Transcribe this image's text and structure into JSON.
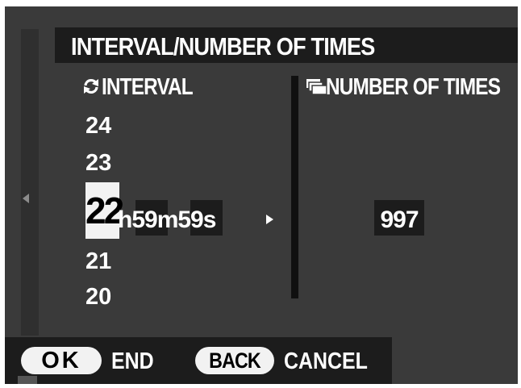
{
  "title": "INTERVAL/NUMBER OF TIMES",
  "interval": {
    "header": "INTERVAL",
    "icon": "cycle-arrows-icon",
    "hours_above": [
      "24",
      "23"
    ],
    "hours_selected": "22",
    "time_suffix": "h59m59s",
    "hours_below": [
      "21",
      "20"
    ]
  },
  "number_of_times": {
    "header": "NUMBER OF TIMES",
    "icon": "stacked-frames-icon",
    "value": "997"
  },
  "footer": {
    "ok_button": "OK",
    "ok_action": "END",
    "back_button": "BACK",
    "back_action": "CANCEL"
  },
  "colors": {
    "background": "#3a3a3a",
    "panel": "#1c1c1c",
    "highlight": "#f2f2f2",
    "text": "#ffffff"
  }
}
